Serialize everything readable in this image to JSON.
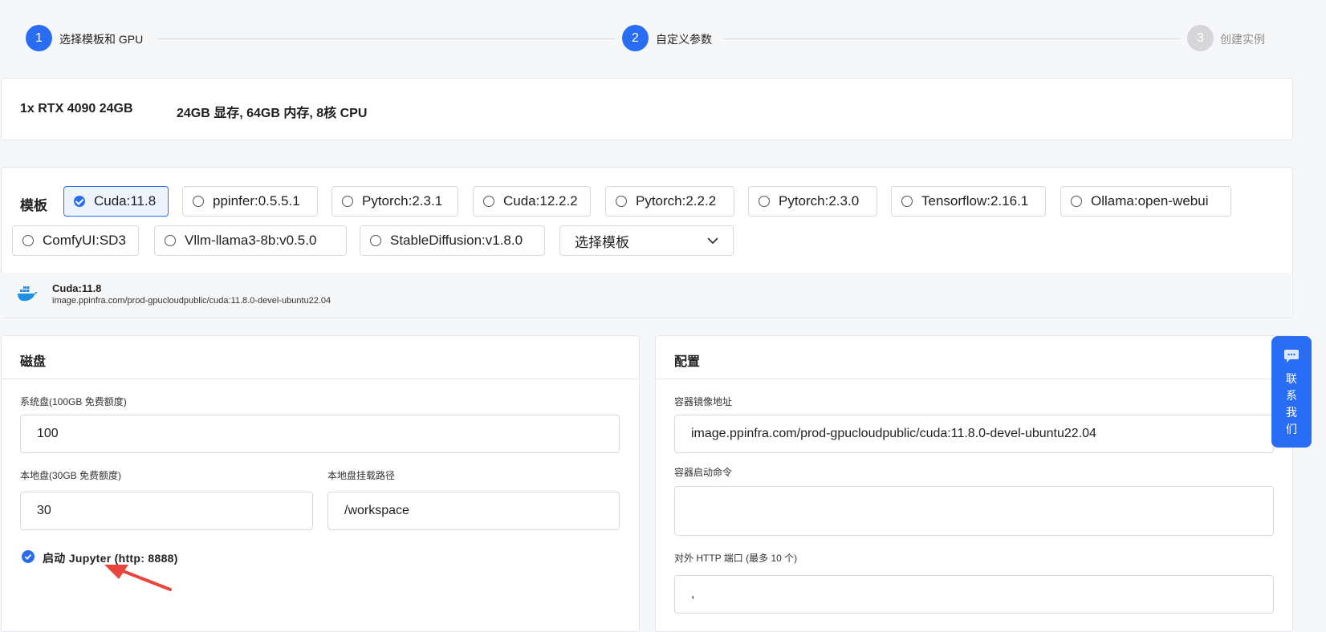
{
  "stepper": {
    "steps": [
      {
        "number": "1",
        "label": "选择模板和 GPU"
      },
      {
        "number": "2",
        "label": "自定义参数"
      },
      {
        "number": "3",
        "label": "创建实例"
      }
    ]
  },
  "gpu": {
    "name": "1x RTX 4090 24GB",
    "spec": "24GB 显存, 64GB 内存, 8核 CPU"
  },
  "templates": {
    "label": "模板",
    "options": [
      {
        "label": "Cuda:11.8",
        "selected": true
      },
      {
        "label": "ppinfer:0.5.5.1",
        "selected": false
      },
      {
        "label": "Pytorch:2.3.1",
        "selected": false
      },
      {
        "label": "Cuda:12.2.2",
        "selected": false
      },
      {
        "label": "Pytorch:2.2.2",
        "selected": false
      },
      {
        "label": "Pytorch:2.3.0",
        "selected": false
      },
      {
        "label": "Tensorflow:2.16.1",
        "selected": false
      },
      {
        "label": "Ollama:open-webui",
        "selected": false
      },
      {
        "label": "ComfyUI:SD3",
        "selected": false
      },
      {
        "label": "Vllm-llama3-8b:v0.5.0",
        "selected": false
      },
      {
        "label": "StableDiffusion:v1.8.0",
        "selected": false
      }
    ],
    "select_value": "选择模板",
    "selected_info": {
      "name": "Cuda:11.8",
      "image": "image.ppinfra.com/prod-gpucloudpublic/cuda:11.8.0-devel-ubuntu22.04"
    }
  },
  "disk": {
    "title": "磁盘",
    "system_label": "系统盘(100GB 免费额度)",
    "system_value": "100",
    "local_label": "本地盘(30GB 免费额度)",
    "local_value": "30",
    "mount_label": "本地盘挂载路径",
    "mount_value": "/workspace",
    "jupyter_label": "启动 Jupyter (http: 8888)"
  },
  "config": {
    "title": "配置",
    "image_label": "容器镜像地址",
    "image_value": "image.ppinfra.com/prod-gpucloudpublic/cuda:11.8.0-devel-ubuntu22.04",
    "cmd_label": "容器启动命令",
    "cmd_value": "",
    "port_label": "对外 HTTP 端口 (最多 10 个)",
    "port_value": ","
  },
  "contact": {
    "label": "联系我们"
  },
  "colors": {
    "accent": "#2a6df5",
    "annotation_arrow": "#e8453c"
  }
}
